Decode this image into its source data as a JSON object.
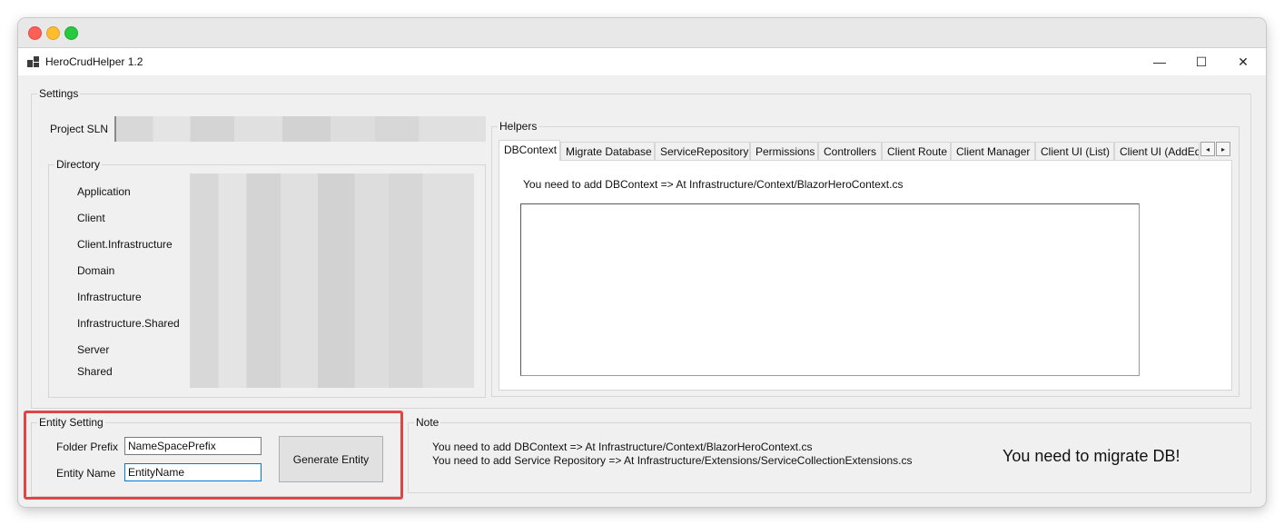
{
  "window": {
    "title": "HeroCrudHelper 1.2",
    "minimize": "—",
    "maximize": "☐",
    "close": "✕"
  },
  "settings": {
    "group_label": "Settings",
    "project_sln_label": "Project SLN",
    "directory": {
      "group_label": "Directory",
      "items": [
        "Application",
        "Client",
        "Client.Infrastructure",
        "Domain",
        "Infrastructure",
        "Infrastructure.Shared",
        "Server",
        "Shared"
      ]
    }
  },
  "helpers": {
    "group_label": "Helpers",
    "tabs": [
      "DBContext",
      "Migrate Database",
      "ServiceRepository",
      "Permissions",
      "Controllers",
      "Client Route",
      "Client Manager",
      "Client UI (List)",
      "Client UI (AddEd"
    ],
    "active_tab": "DBContext",
    "instruction": "You need to add DBContext => At Infrastructure/Context/BlazorHeroContext.cs",
    "scroll_left": "◂",
    "scroll_right": "▸"
  },
  "entity_setting": {
    "group_label": "Entity Setting",
    "folder_prefix_label": "Folder Prefix",
    "folder_prefix_value": "NameSpacePrefix",
    "entity_name_label": "Entity Name",
    "entity_name_value": "EntityName",
    "generate_button": "Generate Entity"
  },
  "note": {
    "group_label": "Note",
    "lines": [
      "You need to add DBContext => At Infrastructure/Context/BlazorHeroContext.cs",
      "You need to add Service Repository => At Infrastructure/Extensions/ServiceCollectionExtensions.cs"
    ],
    "migrate_message": "You need to migrate DB!"
  },
  "colors": {
    "highlight": "#e04545",
    "focus": "#0078d7",
    "window_bg": "#f0f0f0"
  }
}
